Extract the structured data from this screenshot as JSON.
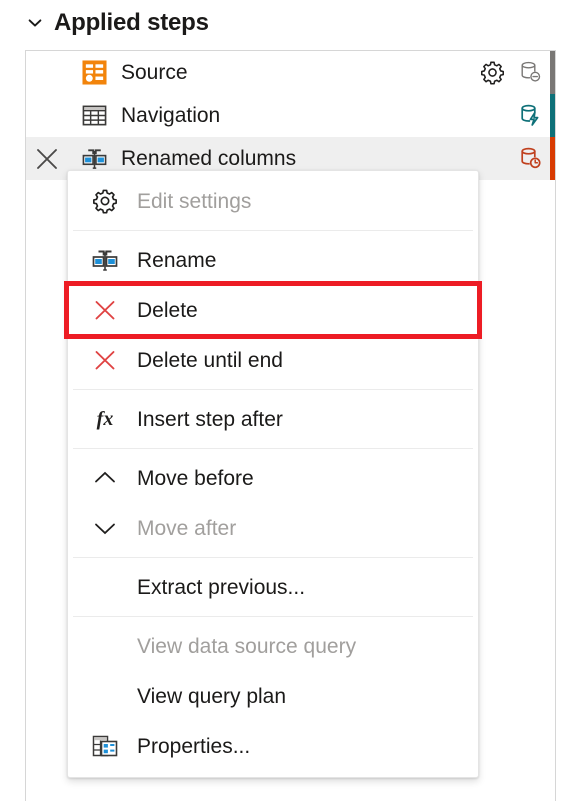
{
  "header": {
    "chevron_icon": "chevron-down-icon",
    "title": "Applied steps"
  },
  "steps": {
    "items": [
      {
        "label": "Source",
        "icon": "source-step-icon",
        "selected": false,
        "has_gear": true,
        "gear_icon": "gear-icon",
        "fold_icon": "folding-not-supported-icon",
        "fold_color": "#797775",
        "bar_color": "#797775"
      },
      {
        "label": "Navigation",
        "icon": "table-step-icon",
        "selected": false,
        "has_gear": false,
        "gear_icon": "",
        "fold_icon": "folding-supported-icon",
        "fold_color": "#0e7078",
        "bar_color": "#0e7078"
      },
      {
        "label": "Renamed columns",
        "icon": "rename-columns-step-icon",
        "selected": true,
        "has_gear": false,
        "gear_icon": "",
        "fold_icon": "folding-evaluation-pending-icon",
        "fold_color": "#c0401e",
        "bar_color": "#d83b01",
        "delete_icon": "close-icon"
      }
    ]
  },
  "context_menu": {
    "items": [
      {
        "label": "Edit settings",
        "icon": "gear-icon",
        "disabled": true,
        "highlighted": false,
        "separator_after": true
      },
      {
        "label": "Rename",
        "icon": "rename-icon",
        "disabled": false,
        "highlighted": false,
        "separator_after": false
      },
      {
        "label": "Delete",
        "icon": "delete-x-icon",
        "disabled": false,
        "highlighted": true,
        "separator_after": false
      },
      {
        "label": "Delete until end",
        "icon": "delete-x-icon",
        "disabled": false,
        "highlighted": false,
        "separator_after": true
      },
      {
        "label": "Insert step after",
        "icon": "fx-icon",
        "disabled": false,
        "highlighted": false,
        "separator_after": true
      },
      {
        "label": "Move before",
        "icon": "chevron-up-icon",
        "disabled": false,
        "highlighted": false,
        "separator_after": false
      },
      {
        "label": "Move after",
        "icon": "chevron-down-icon",
        "disabled": true,
        "highlighted": false,
        "separator_after": true
      },
      {
        "label": "Extract previous...",
        "icon": "",
        "disabled": false,
        "highlighted": false,
        "separator_after": true
      },
      {
        "label": "View data source query",
        "icon": "",
        "disabled": true,
        "highlighted": false,
        "separator_after": false
      },
      {
        "label": "View query plan",
        "icon": "",
        "disabled": false,
        "highlighted": false,
        "separator_after": false
      },
      {
        "label": "Properties...",
        "icon": "properties-icon",
        "disabled": false,
        "highlighted": false,
        "separator_after": false
      }
    ]
  },
  "colors": {
    "highlight_box": "#ed1c24",
    "source_icon": "#f2840b",
    "accent_blue": "#1e90d8",
    "delete_red": "#e04343",
    "selected_row_bg": "#efefef",
    "disabled_text": "#a19f9d",
    "text": "#1b1a19"
  }
}
